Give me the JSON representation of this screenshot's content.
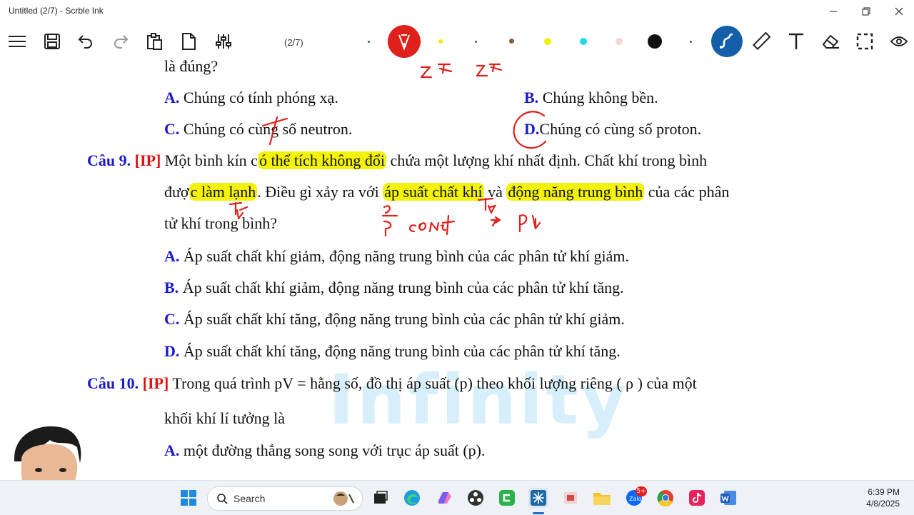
{
  "window": {
    "title": "Untitled (2/7) - Scrble Ink"
  },
  "toolbar": {
    "page_indicator": "(2/7)"
  },
  "colors": {
    "pen_red": "#e0201a",
    "pen_blue": "#1663c0",
    "highlight": "#f2f20a",
    "label_blue": "#1a1acd",
    "tag_red": "#e01010"
  },
  "icons": [
    "menu-icon",
    "save-icon",
    "undo-icon",
    "redo-icon",
    "clipboard-icon",
    "new-page-icon",
    "sliders-icon",
    "pen-icon",
    "ruler-icon",
    "text-icon",
    "eraser-icon",
    "select-icon",
    "view-icon"
  ],
  "doc": {
    "l0": "là đúng?",
    "a_lbl": "A.",
    "a_txt": "Chúng có tính phóng xạ.",
    "b_lbl": "B.",
    "b_txt": "Chúng không bền.",
    "c_lbl": "C.",
    "c_txt1": "Chúng có ",
    "c_txt2": "cùng",
    "c_txt3": " số neutron.",
    "d_lbl": "D.",
    "d_txt": "Chúng có cùng số proton.",
    "q9_no": "Câu 9.",
    "q9_tag": "[IP]",
    "q9_p1": " Một bình kín c",
    "q9_h1": "ó thể tích không đổi",
    "q9_p2": " chứa một lượng khí nhất định. Chất khí trong bình",
    "q9_p3": "đượ",
    "q9_h2": "c làm lạnh",
    "q9_p4": ". Điều gì xảy ra với ",
    "q9_h3": "áp suất chất khí",
    "q9_p5": " và ",
    "q9_h4": "động năng trung bình",
    "q9_p6": " của các phân",
    "q9_p7": "tử khí trong bình?",
    "q9_a_lbl": "A.",
    "q9_a": "Áp suất chất khí giảm, động năng trung bình của các phân tử khí giảm.",
    "q9_b_lbl": "B.",
    "q9_b": "Áp suất chất khí giảm, động năng trung bình của các phân tử khí tăng.",
    "q9_c_lbl": "C.",
    "q9_c": "Áp suất chất khí tăng, động năng trung bình của các phân tử khí giảm.",
    "q9_d_lbl": "D.",
    "q9_d": "Áp suất chất khí tăng, động năng trung bình của các phân tử khí tăng.",
    "q10_no": "Câu 10.",
    "q10_tag": "[IP]",
    "q10_p1": " Trong quá trình  pV =  hằng số, đồ thị áp suất (p) theo khối lượng riêng (  ρ ) của một",
    "q10_p2": "khối khí lí tưởng là",
    "q10_a_lbl": "A.",
    "q10_a": "một đường thẳng song song với trục áp suất (p).",
    "watermark": "Infinity"
  },
  "taskbar": {
    "search_placeholder": "Search",
    "time": "6:39 PM",
    "date": "4/8/2025",
    "badge": "5+"
  }
}
